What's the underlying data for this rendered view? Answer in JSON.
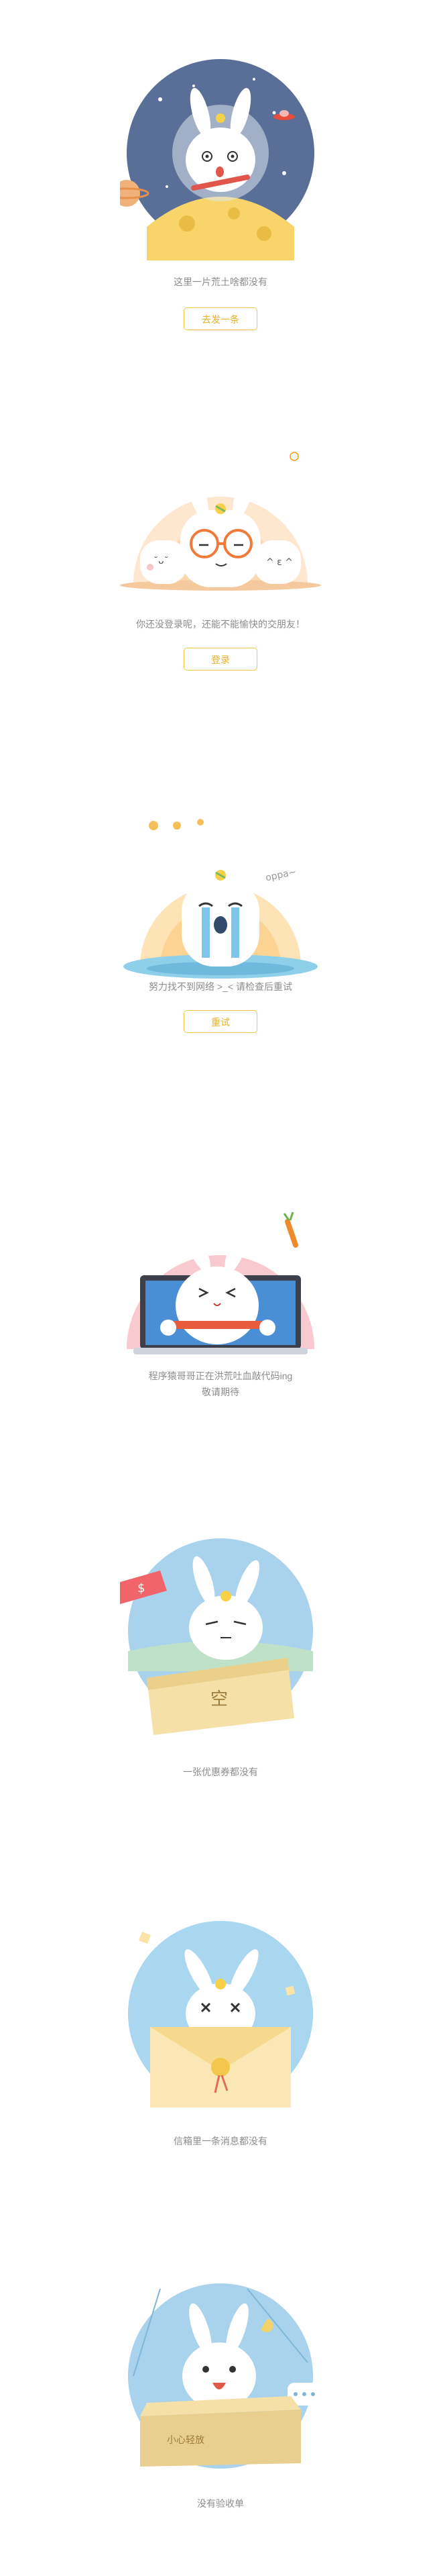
{
  "colors": {
    "accent": "#f5c542",
    "caption": "#8c8c8c",
    "bunny": "#ffffff"
  },
  "states": [
    {
      "illustration": "bunny-astronaut-on-moon",
      "message": "这里一片荒土啥都没有",
      "button": "去发一条"
    },
    {
      "illustration": "bunny-with-glasses-friends",
      "message": "你还没登录呢，还能不能愉快的交朋友！",
      "button": "登录"
    },
    {
      "illustration": "bunny-crying-no-network",
      "message": "努力找不到网络 >_< 请检查后重试",
      "button": "重试",
      "bubble_text": "oppa~"
    },
    {
      "illustration": "bunny-coding-laptop",
      "message_line1": "程序猿哥哥正在洪荒吐血敲代码ing",
      "message_line2": "敬请期待"
    },
    {
      "illustration": "bunny-empty-coupon",
      "message": "一张优惠券都没有",
      "coupon_char": "空",
      "flag_symbol": "$"
    },
    {
      "illustration": "bunny-empty-mailbox",
      "message": "信箱里一条消息都没有"
    },
    {
      "illustration": "bunny-no-order-box",
      "message": "没有验收单",
      "box_label": "小心轻放"
    }
  ]
}
